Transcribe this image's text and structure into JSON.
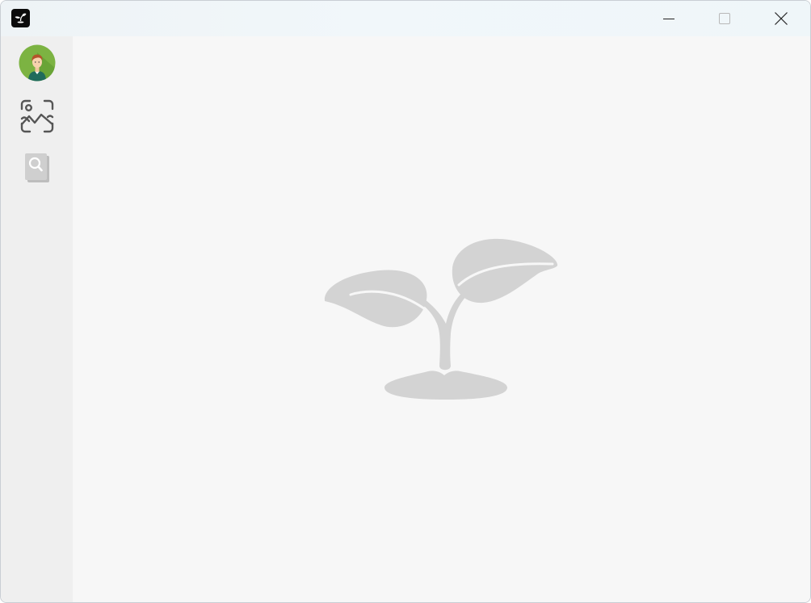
{
  "window": {
    "title": "",
    "controls": [
      "minimize",
      "maximize",
      "close"
    ]
  },
  "titlebar": {
    "app_icon": "sprout-logo-icon",
    "minimize_icon": "minimize-icon",
    "maximize_icon": "maximize-icon",
    "close_icon": "close-icon"
  },
  "sidebar": {
    "items": [
      {
        "icon": "user-avatar",
        "active": true
      },
      {
        "icon": "image-scan-icon",
        "active": true
      },
      {
        "icon": "search-document-icon",
        "active": false
      }
    ]
  },
  "main": {
    "placeholder_icon": "sprout-placeholder-icon"
  },
  "colors": {
    "titlebar_bg": "#eef4f7",
    "sidebar_bg": "#efefef",
    "content_bg": "#f7f7f7",
    "placeholder_fill": "#d3d3d3",
    "icon_dark": "#555555",
    "avatar_green": "#7cb342"
  }
}
